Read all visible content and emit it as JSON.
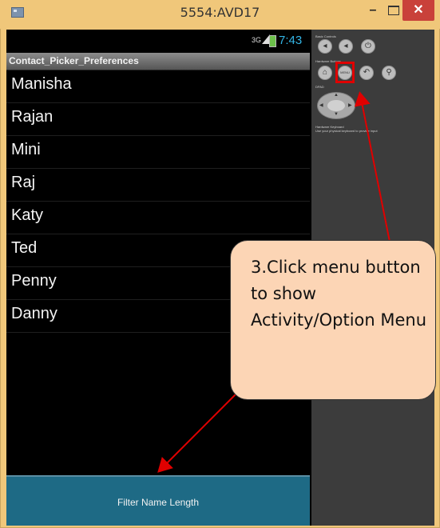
{
  "window": {
    "title": "5554:AVD17",
    "minimize_label": "–",
    "close_label": "✕"
  },
  "status_bar": {
    "network": "3G",
    "time": "7:43"
  },
  "app": {
    "title": "Contact_Picker_Preferences",
    "contacts": [
      "Manisha",
      "Rajan",
      "Mini",
      "Raj",
      "Katy",
      "Ted",
      "Penny",
      "Danny"
    ],
    "menu_item": "Filter Name Length"
  },
  "controls": {
    "basic_label": "Basic Controls",
    "hardware_label": "Hardware Buttons",
    "dpad_label": "DPAD",
    "keyboard_label": "Hardware Keyboard",
    "keyboard_hint": "Use your physical keyboard to provide input",
    "menu_button_label": "MENU",
    "icons": {
      "volume_down": "volume-down-icon",
      "volume_up": "volume-up-icon",
      "power": "power-icon",
      "home": "home-icon",
      "back": "back-icon",
      "search": "search-icon"
    }
  },
  "callout": {
    "text": "3.Click menu button to show Activity/Option Menu"
  },
  "colors": {
    "annotation_red": "#e00000",
    "callout_fill": "#fcd5b5",
    "menu_bar": "#1e6a85",
    "clock": "#33b5e5"
  }
}
